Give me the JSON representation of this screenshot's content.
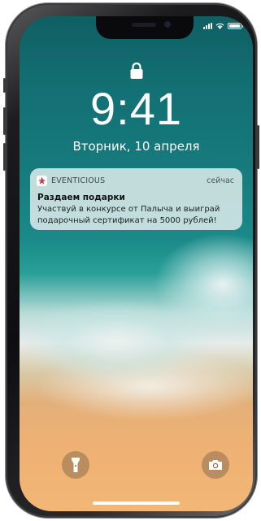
{
  "lock_screen": {
    "time": "9:41",
    "date": "Вторник, 10 апреля"
  },
  "notification": {
    "app_name": "EVENTICIOUS",
    "time": "сейчас",
    "title": "Раздаем подарки",
    "body": "Участвуй в конкурсе от Палыча и выиграй подарочный сертификат на 5000 рублей!",
    "app_icon_color": "#e53935"
  },
  "status_bar": {
    "icons": [
      "cellular-signal-icon",
      "wifi-icon",
      "battery-icon"
    ]
  },
  "quick_actions": {
    "left": "flashlight-icon",
    "right": "camera-icon"
  }
}
